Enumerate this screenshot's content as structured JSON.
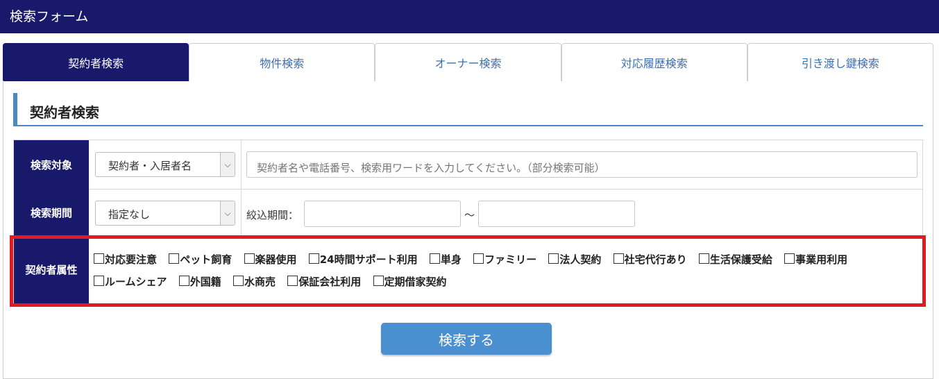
{
  "header": {
    "title": "検索フォーム"
  },
  "tabs": [
    {
      "label": "契約者検索",
      "active": true
    },
    {
      "label": "物件検索",
      "active": false
    },
    {
      "label": "オーナー検索",
      "active": false
    },
    {
      "label": "対応履歴検索",
      "active": false
    },
    {
      "label": "引き渡し鍵検索",
      "active": false
    }
  ],
  "section": {
    "title": "契約者検索"
  },
  "form": {
    "search_target": {
      "label": "検索対象",
      "select_value": "契約者・入居者名",
      "input_placeholder": "契約者名や電話番号、検索用ワードを入力してください。（部分検索可能）",
      "input_value": ""
    },
    "search_period": {
      "label": "検索期間",
      "select_value": "指定なし",
      "range_label": "絞込期間：",
      "separator": "〜",
      "from_value": "",
      "to_value": ""
    },
    "attributes": {
      "label": "契約者属性",
      "options": [
        {
          "label": "対応要注意",
          "checked": false
        },
        {
          "label": "ペット飼育",
          "checked": false
        },
        {
          "label": "楽器使用",
          "checked": false
        },
        {
          "label": "24時間サポート利用",
          "checked": false
        },
        {
          "label": "単身",
          "checked": false
        },
        {
          "label": "ファミリー",
          "checked": false
        },
        {
          "label": "法人契約",
          "checked": false
        },
        {
          "label": "社宅代行あり",
          "checked": false
        },
        {
          "label": "生活保護受給",
          "checked": false
        },
        {
          "label": "事業用利用",
          "checked": false
        },
        {
          "label": "ルームシェア",
          "checked": false
        },
        {
          "label": "外国籍",
          "checked": false
        },
        {
          "label": "水商売",
          "checked": false
        },
        {
          "label": "保証会社利用",
          "checked": false
        },
        {
          "label": "定期借家契約",
          "checked": false
        }
      ]
    }
  },
  "actions": {
    "search_label": "検索する"
  },
  "colors": {
    "primary": "#19196b",
    "accent": "#4a89c4",
    "highlight": "#e21b23",
    "button": "#4a8fd0"
  }
}
